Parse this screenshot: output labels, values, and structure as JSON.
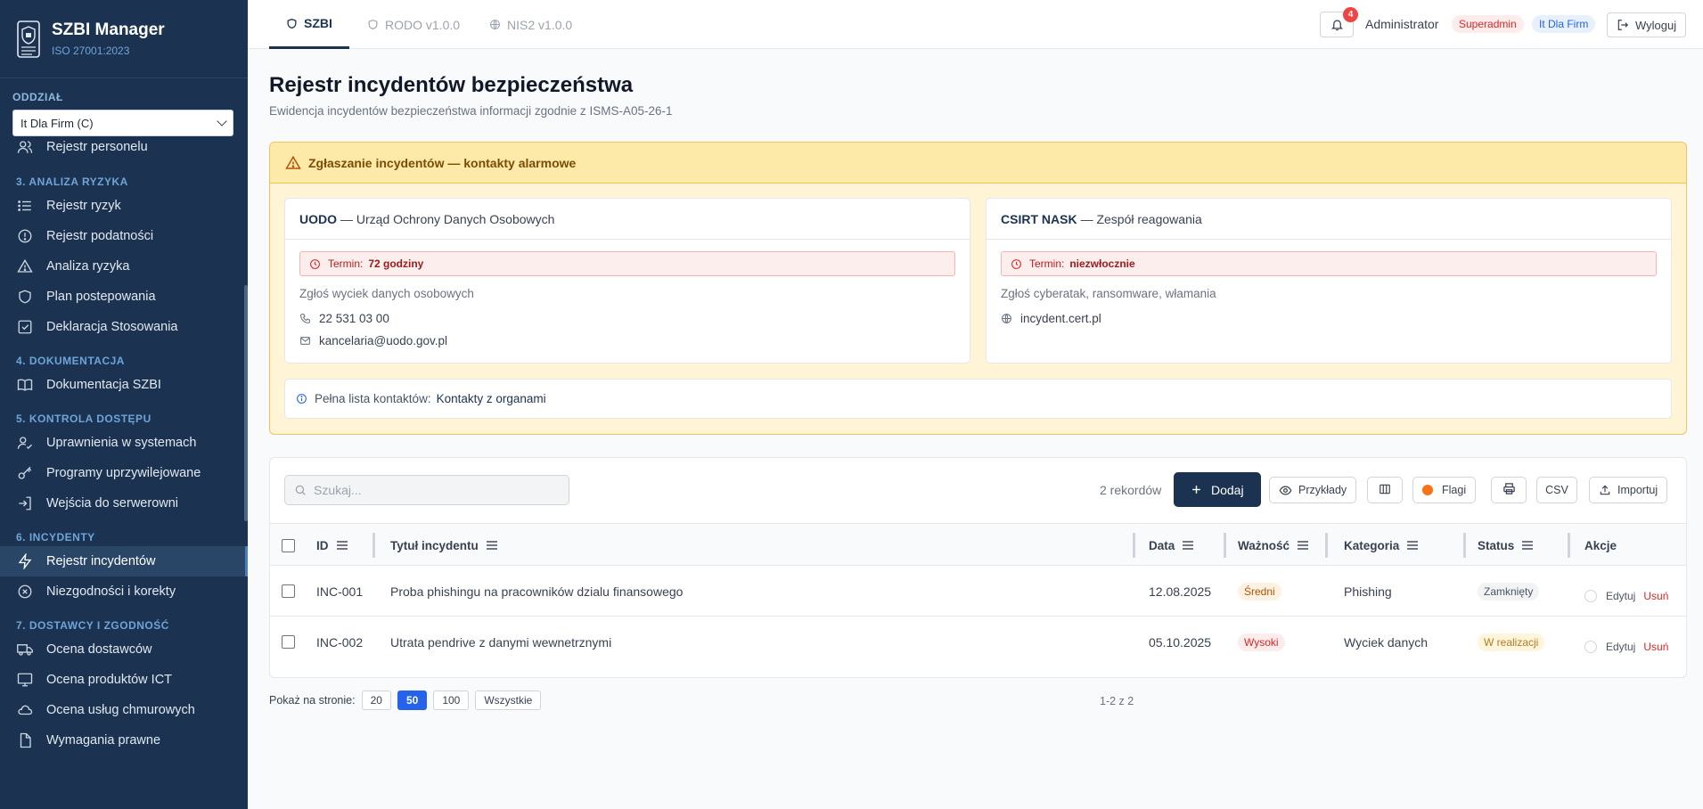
{
  "app": {
    "title": "SZBI Manager",
    "subtitle": "ISO 27001:2023"
  },
  "branch": {
    "label": "ODDZIAŁ",
    "selected": "It Dla Firm (C)"
  },
  "sidebar": {
    "partial_item": {
      "label": "Rejestr personelu",
      "icon": "users-icon"
    },
    "sections": [
      {
        "title": "3. ANALIZA RYZYKA",
        "items": [
          {
            "label": "Rejestr ryzyk",
            "icon": "list-icon"
          },
          {
            "label": "Rejestr podatności",
            "icon": "alert-circle-icon"
          },
          {
            "label": "Analiza ryzyka",
            "icon": "warning-icon"
          },
          {
            "label": "Plan postepowania",
            "icon": "shield-icon"
          },
          {
            "label": "Deklaracja Stosowania",
            "icon": "check-square-icon"
          }
        ]
      },
      {
        "title": "4. DOKUMENTACJA",
        "items": [
          {
            "label": "Dokumentacja SZBI",
            "icon": "book-icon"
          }
        ]
      },
      {
        "title": "5. KONTROLA DOSTĘPU",
        "items": [
          {
            "label": "Uprawnienia w systemach",
            "icon": "user-check-icon"
          },
          {
            "label": "Programy uprzywilejowane",
            "icon": "key-icon"
          },
          {
            "label": "Wejścia do serwerowni",
            "icon": "log-in-icon"
          }
        ]
      },
      {
        "title": "6. INCYDENTY",
        "items": [
          {
            "label": "Rejestr incydentów",
            "icon": "zap-icon",
            "active": true
          },
          {
            "label": "Niezgodności i korekty",
            "icon": "x-circle-icon"
          }
        ]
      },
      {
        "title": "7. DOSTAWCY I ZGODNOŚĆ",
        "items": [
          {
            "label": "Ocena dostawców",
            "icon": "truck-icon"
          },
          {
            "label": "Ocena produktów ICT",
            "icon": "monitor-icon"
          },
          {
            "label": "Ocena usług chmurowych",
            "icon": "cloud-icon"
          },
          {
            "label": "Wymagania prawne",
            "icon": "file-icon"
          }
        ]
      }
    ]
  },
  "tabs": [
    {
      "label": "SZBI",
      "icon": "shield-icon",
      "active": true
    },
    {
      "label": "RODO v1.0.0",
      "icon": "shield-icon"
    },
    {
      "label": "NIS2 v1.0.0",
      "icon": "globe-icon"
    }
  ],
  "header": {
    "notifications": "4",
    "user": "Administrator",
    "role_badge": "Superadmin",
    "org_badge": "It Dla Firm",
    "logout": "Wyloguj"
  },
  "page": {
    "title": "Rejestr incydentów bezpieczeństwa",
    "subtitle": "Ewidencja incydentów bezpieczeństwa informacji zgodnie z ISMS-A05-26-1"
  },
  "alert": {
    "title": "Zgłaszanie incydentów — kontakty alarmowe",
    "contacts": [
      {
        "org": "UODO",
        "name": "— Urząd Ochrony Danych Osobowych",
        "deadline_label": "Termin:",
        "deadline_value": "72 godziny",
        "description": "Zgłoś wyciek danych osobowych",
        "phone": "22 531 03 00",
        "email": "kancelaria@uodo.gov.pl"
      },
      {
        "org": "CSIRT NASK",
        "name": "— Zespół reagowania",
        "deadline_label": "Termin:",
        "deadline_value": "niezwłocznie",
        "description": "Zgłoś cyberatak, ransomware, włamania",
        "website": "incydent.cert.pl"
      }
    ],
    "full_list_label": "Pełna lista kontaktów:",
    "full_list_link": "Kontakty z organami"
  },
  "toolbar": {
    "search_placeholder": "Szukaj...",
    "count": "2 rekordów",
    "add": "Dodaj",
    "examples": "Przykłady",
    "flags": "Flagi",
    "csv": "CSV",
    "import": "Importuj"
  },
  "table": {
    "columns": [
      "ID",
      "Tytuł incydentu",
      "Data",
      "Ważność",
      "Kategoria",
      "Status",
      "Akcje"
    ],
    "rows": [
      {
        "id": "INC-001",
        "title": "Proba phishingu na pracowników dzialu finansowego",
        "date": "12.08.2025",
        "severity": "Średni",
        "category": "Phishing",
        "status": "Zamknięty"
      },
      {
        "id": "INC-002",
        "title": "Utrata pendrive z danymi wewnetrznymi",
        "date": "05.10.2025",
        "severity": "Wysoki",
        "category": "Wyciek danych",
        "status": "W realizacji"
      }
    ],
    "edit_label": "Edytuj",
    "delete_label": "Usuń"
  },
  "pagination": {
    "label": "Pokaż na stronie:",
    "options": [
      "20",
      "50",
      "100",
      "Wszystkie"
    ],
    "selected": "50",
    "range": "1-2 z 2"
  },
  "colors": {
    "sidebar": "#1b3350",
    "primary": "#1b3350",
    "accent": "#2563eb",
    "danger": "#dc2626",
    "warning_bg": "#fff4d6"
  }
}
